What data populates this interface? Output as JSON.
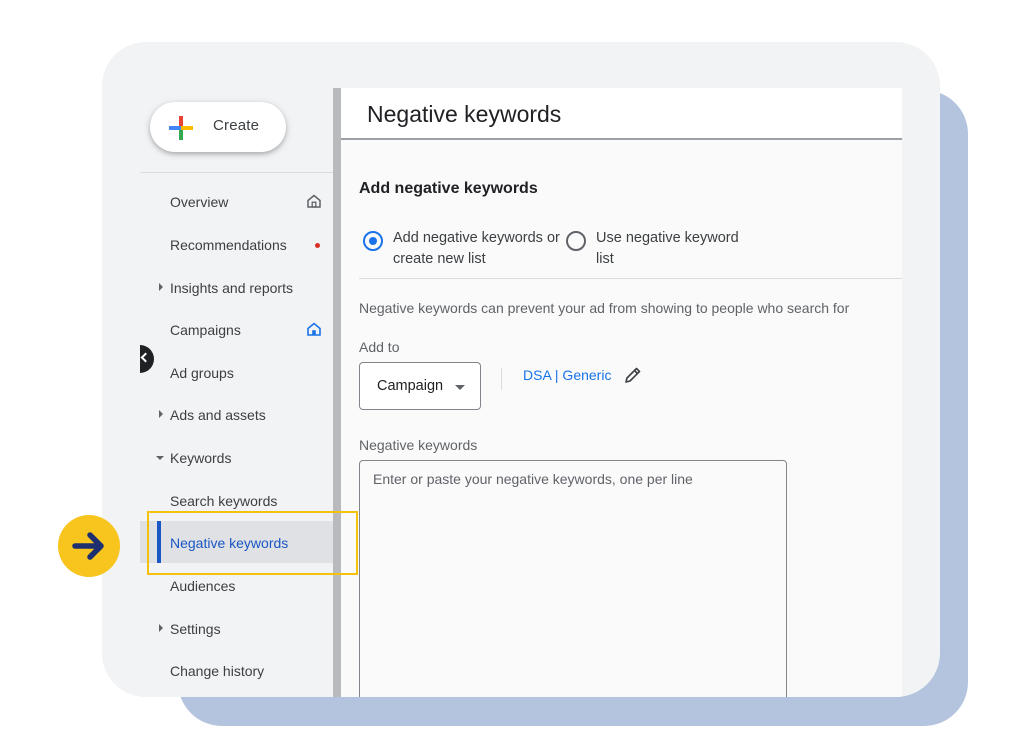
{
  "create_button": {
    "label": "Create"
  },
  "sidebar": {
    "items": [
      {
        "label": "Overview"
      },
      {
        "label": "Recommendations"
      },
      {
        "label": "Insights and reports"
      },
      {
        "label": "Campaigns"
      },
      {
        "label": "Ad groups"
      },
      {
        "label": "Ads and assets"
      },
      {
        "label": "Keywords"
      },
      {
        "label": "Search keywords"
      },
      {
        "label": "Negative keywords",
        "active": true
      },
      {
        "label": "Audiences"
      },
      {
        "label": "Settings"
      },
      {
        "label": "Change history"
      }
    ]
  },
  "main": {
    "page_title": "Negative keywords",
    "section_title": "Add negative keywords",
    "options": [
      {
        "label": "Add negative keywords or create new list",
        "selected": true
      },
      {
        "label": "Use negative keyword list",
        "selected": false
      }
    ],
    "description": "Negative keywords can prevent your ad from showing to people who search for",
    "add_to": {
      "label": "Add to",
      "selected": "Campaign",
      "target_link": "DSA | Generic"
    },
    "keywords_field": {
      "label": "Negative keywords",
      "placeholder": "Enter or paste your negative keywords, one per line"
    }
  },
  "colors": {
    "accent": "#1a73e8",
    "active_nav": "#1a56c4",
    "highlight": "#f4c20d",
    "badge": "#f7c51e",
    "notification_dot": "#d93025"
  },
  "icons": [
    "google-plus-icon",
    "home-icon",
    "notification-dot-icon",
    "pencil-icon",
    "arrow-right-icon",
    "chevron-left-icon"
  ]
}
